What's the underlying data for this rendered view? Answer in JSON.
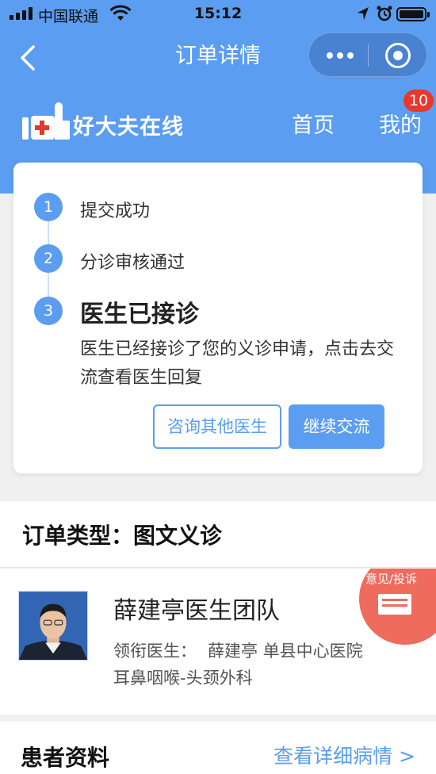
{
  "status_bar": {
    "carrier": "中国联通",
    "time": "15:12"
  },
  "nav": {
    "title": "订单详情"
  },
  "brand": {
    "name": "好大夫在线",
    "home_label": "首页",
    "mine_label": "我的",
    "badge_count": "10"
  },
  "progress": {
    "steps": [
      {
        "num": "1",
        "label": "提交成功"
      },
      {
        "num": "2",
        "label": "分诊审核通过"
      },
      {
        "num": "3",
        "label": "医生已接诊"
      }
    ],
    "description": "医生已经接诊了您的义诊申请，点击去交流查看医生回复",
    "btn_other": "咨询其他医生",
    "btn_continue": "继续交流"
  },
  "order": {
    "type_label": "订单类型：图文义诊"
  },
  "doctor": {
    "team_name": "薛建亭医生团队",
    "lead_label": "领衔医生：",
    "lead_value": "薛建亭 单县中心医院",
    "department": "耳鼻咽喉-头颈外科",
    "feedback_label": "意见/投诉"
  },
  "patient": {
    "title": "患者资料",
    "view_detail": "查看详细病情 >"
  },
  "colors": {
    "accent": "#5b9df0",
    "badge": "#e8372b",
    "feedback": "#ee6b5d"
  }
}
